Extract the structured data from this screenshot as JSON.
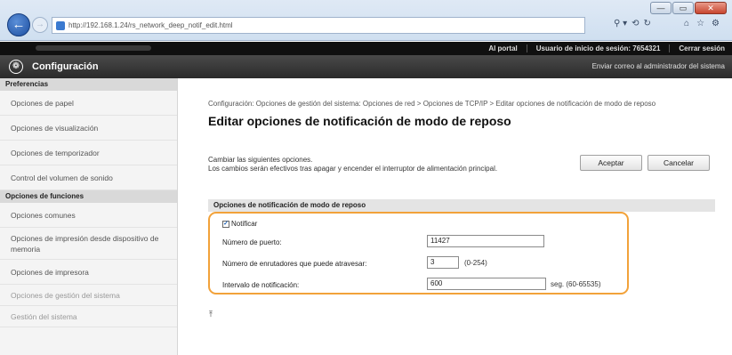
{
  "browser": {
    "url": "http://192.168.1.24/rs_network_deep_notif_edit.html",
    "back_icon": "back-arrow-icon",
    "forward_icon": "forward-arrow-icon",
    "addr_tools": [
      "⚲ ▾",
      "⟲",
      "↻"
    ],
    "right_tools": [
      "⌂",
      "☆",
      "⚙"
    ],
    "window_buttons": [
      "—",
      "▭",
      "✕"
    ]
  },
  "topbar": {
    "portal": "Al portal",
    "user_label": "Usuario de inicio de sesión:",
    "user_id": "7654321",
    "logout": "Cerrar sesión"
  },
  "header": {
    "title": "Configuración",
    "mail": "Enviar correo al administrador del sistema"
  },
  "sidebar": {
    "head_pref": "Preferencias",
    "items_pref": [
      "Opciones de papel",
      "Opciones de visualización",
      "Opciones de temporizador",
      "Control del volumen de sonido"
    ],
    "head_func": "Opciones de funciones",
    "items_func": [
      "Opciones comunes",
      "Opciones de impresión desde dispositivo de memoria",
      "Opciones de impresora"
    ],
    "head_mgmt": "Opciones de gestión del sistema",
    "items_mgmt": [
      "Gestión del sistema"
    ]
  },
  "main": {
    "breadcrumb": "Configuración: Opciones de gestión del sistema: Opciones de red > Opciones de TCP/IP > Editar opciones de notificación de modo de reposo",
    "title": "Editar opciones de notificación de modo de reposo",
    "intro_1": "Cambiar las siguientes opciones.",
    "intro_2": "Los cambios serán efectivos tras apagar y encender el interruptor de alimentación principal.",
    "accept": "Aceptar",
    "cancel": "Cancelar",
    "section_title": "Opciones de notificación de modo de reposo",
    "notify_label": "Notificar",
    "port_label": "Número de puerto:",
    "port_value": "11427",
    "routers_label": "Número de enrutadores que puede atravesar:",
    "routers_value": "3",
    "routers_range": "(0-254)",
    "interval_label": "Intervalo de notificación:",
    "interval_value": "600",
    "interval_unit": "seg. (60-65535)",
    "top_icon": "⤒"
  }
}
